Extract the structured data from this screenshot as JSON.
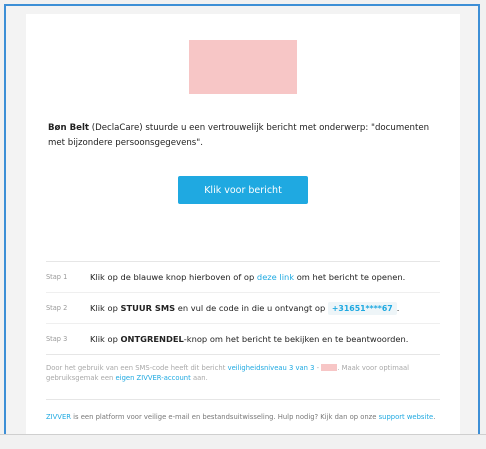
{
  "email": {
    "sender_name": "Bøn Belt",
    "sender_org": "(DeclaCare)",
    "intro_mid": " stuurde u een vertrouwelijk bericht met onderwerp: \"documenten met bijzondere persoonsgegevens\".",
    "cta_label": "Klik voor bericht"
  },
  "steps": [
    {
      "num": "Stap 1",
      "pre": "Klik op de blauwe knop hierboven of op ",
      "link": "deze link",
      "post": " om het bericht te openen."
    },
    {
      "num": "Stap 2",
      "pre": "Klik op ",
      "bold": "STUUR SMS",
      "mid": " en vul de code in die u ontvangt op ",
      "phone": "+31651****67",
      "post": "."
    },
    {
      "num": "Stap 3",
      "pre": "Klik op ",
      "bold": "ONTGRENDEL",
      "post": "-knop om het bericht te bekijken en te beantwoorden."
    }
  ],
  "note": {
    "pre": "Door het gebruik van een SMS-code heeft dit bericht ",
    "level_link": "veiligheidsniveau 3 van 3",
    "mid": " - ",
    "mid2": ". Maak voor optimaal gebruiksgemak een ",
    "account_link": "eigen ZIVVER-account",
    "post": " aan."
  },
  "footer": {
    "brand_link": "ZIVVER",
    "text": " is een platform voor veilige e-mail en bestandsuitwisseling. Hulp nodig? Kijk dan op onze ",
    "support_link": "support website",
    "end": "."
  },
  "colors": {
    "accent": "#1fa9e1",
    "frame": "#3d8fd6",
    "logo_placeholder": "#f7c6c6"
  }
}
